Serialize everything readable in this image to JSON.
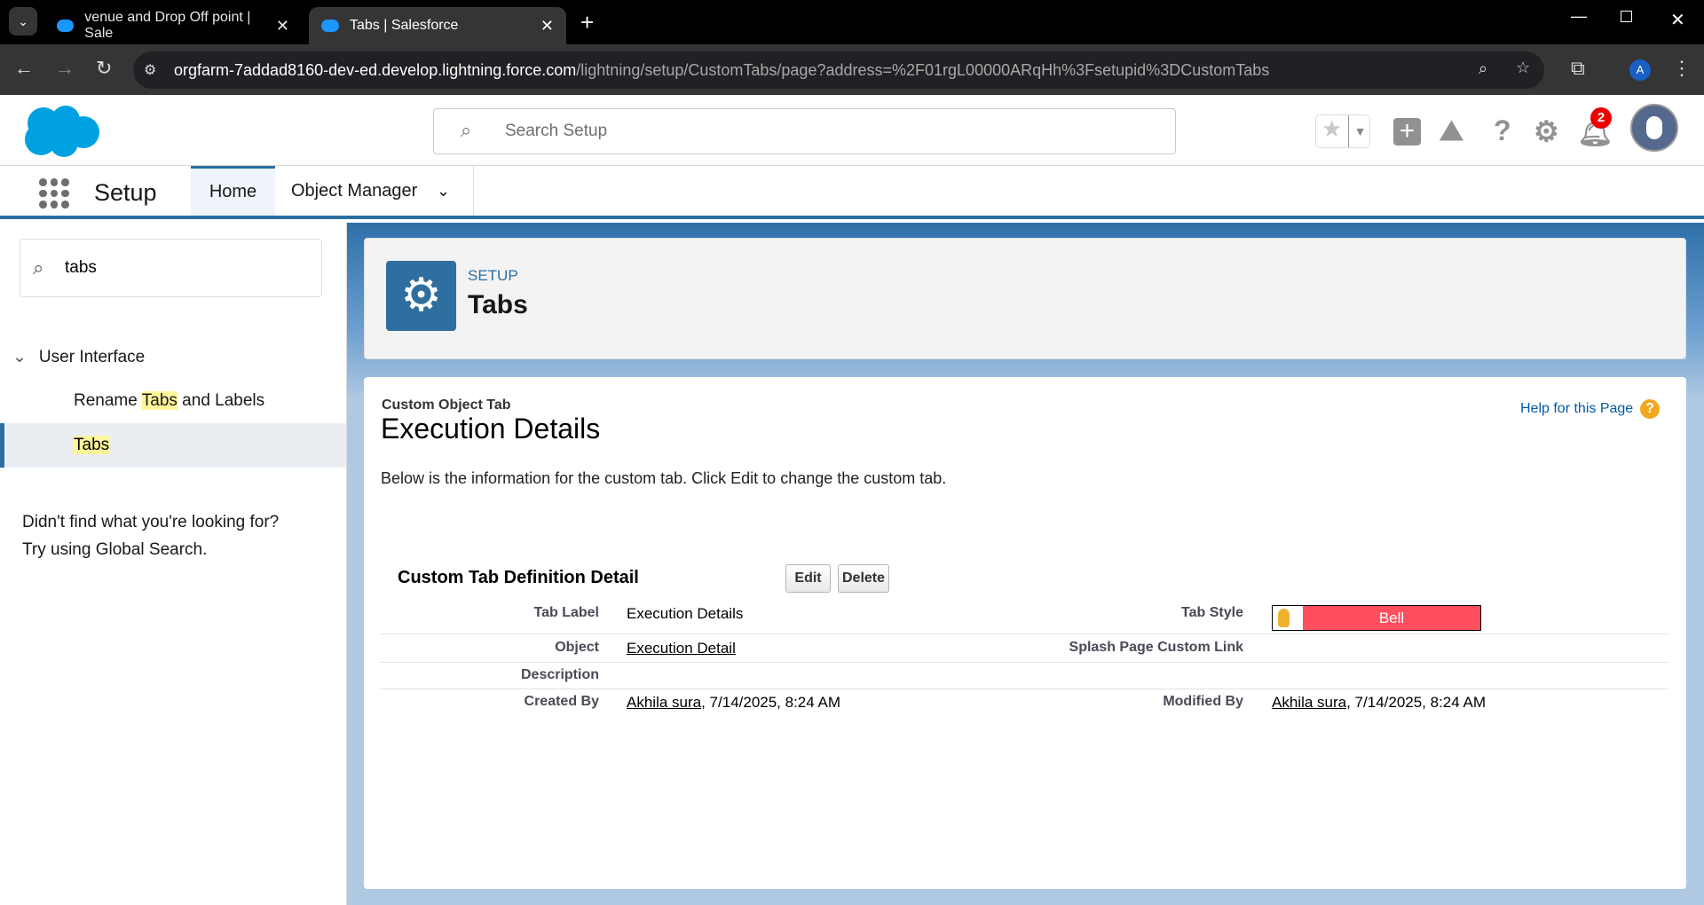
{
  "browser": {
    "tabs": [
      {
        "title": "venue and Drop Off point | Sale"
      },
      {
        "title": "Tabs | Salesforce"
      }
    ],
    "url_host": "orgfarm-7addad8160-dev-ed.develop.lightning.force.com",
    "url_path": "/lightning/setup/CustomTabs/page?address=%2F01rgL00000ARqHh%3Fsetupid%3DCustomTabs",
    "profile_initial": "A"
  },
  "header": {
    "search_placeholder": "Search Setup",
    "notification_count": "2"
  },
  "nav": {
    "app_name": "Setup",
    "tabs": [
      "Home",
      "Object Manager"
    ]
  },
  "sidebar": {
    "search_value": "tabs",
    "section": "User Interface",
    "items": [
      {
        "pre": "Rename ",
        "hl": "Tabs",
        "post": " and Labels"
      },
      {
        "hl": "Tabs"
      }
    ],
    "help1": "Didn't find what you're looking for?",
    "help2": "Try using Global Search."
  },
  "page_header": {
    "eyebrow": "SETUP",
    "title": "Tabs"
  },
  "detail": {
    "type": "Custom Object Tab",
    "title": "Execution Details",
    "help_link": "Help for this Page",
    "intro": "Below is the information for the custom tab. Click Edit to change the custom tab.",
    "section_title": "Custom Tab Definition Detail",
    "edit": "Edit",
    "delete": "Delete",
    "fields": {
      "tab_label_l": "Tab Label",
      "tab_label_v": "Execution Details",
      "tab_style_l": "Tab Style",
      "tab_style_v": "Bell",
      "object_l": "Object",
      "object_v": "Execution Detail",
      "splash_l": "Splash Page Custom Link",
      "description_l": "Description",
      "created_l": "Created By",
      "created_user": "Akhila sura",
      "created_date": ", 7/14/2025, 8:24 AM",
      "modified_l": "Modified By",
      "modified_user": "Akhila sura",
      "modified_date": ", 7/14/2025, 8:24 AM"
    }
  },
  "colors": {
    "brand": "#00a1e0",
    "tab_style": "#ff4f5e",
    "setup_icon": "#2f6f9f"
  }
}
